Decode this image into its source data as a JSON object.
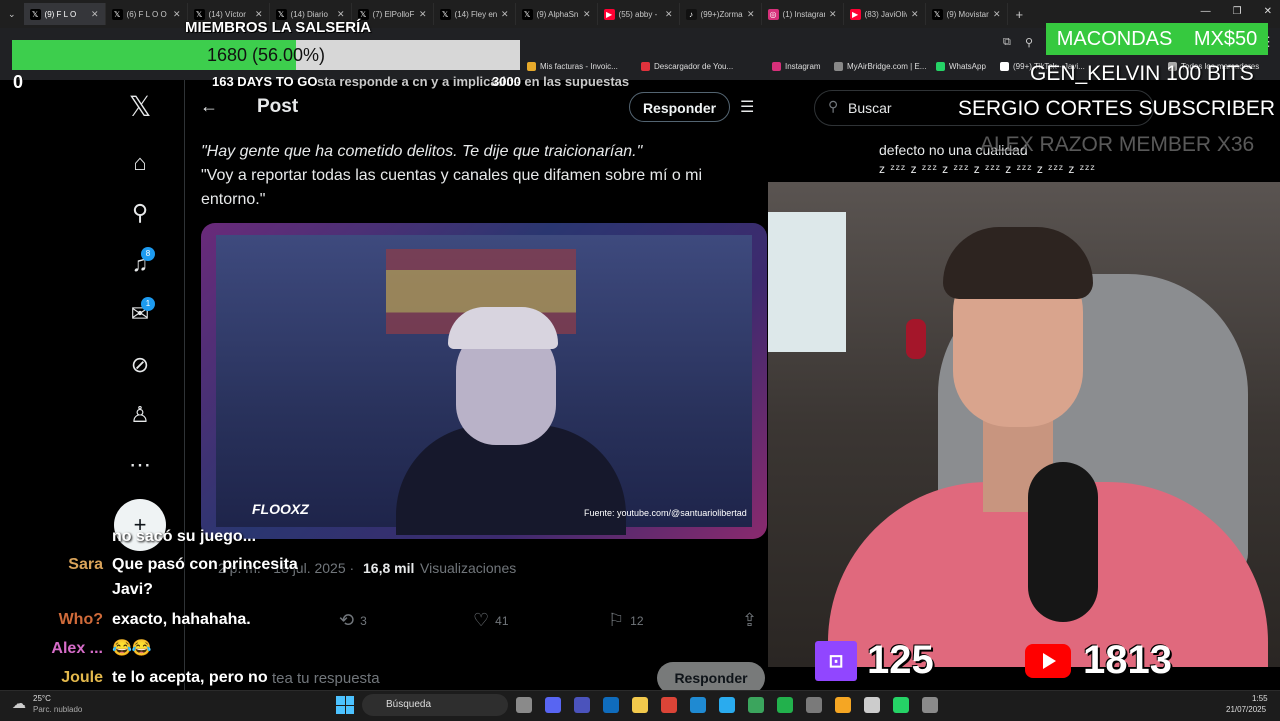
{
  "browser": {
    "tabs": [
      {
        "label": "(9) F L O",
        "icon": "x-icon",
        "active": true
      },
      {
        "label": "(6) F L O O",
        "icon": "x-icon"
      },
      {
        "label": "(14) Víctor",
        "icon": "x-icon"
      },
      {
        "label": "(14) Diario",
        "icon": "x-icon"
      },
      {
        "label": "(7) ElPolloF",
        "icon": "x-icon"
      },
      {
        "label": "(14) Fley en",
        "icon": "x-icon"
      },
      {
        "label": "(9) AlphaSn",
        "icon": "x-icon"
      },
      {
        "label": "(55) abby -",
        "icon": "youtube-icon"
      },
      {
        "label": "(99+)Zorman",
        "icon": "tiktok-icon"
      },
      {
        "label": "(1) Instagram",
        "icon": "instagram-icon"
      },
      {
        "label": "(83) JaviOliv",
        "icon": "youtube-icon"
      },
      {
        "label": "(9) Movistar",
        "icon": "x-icon"
      }
    ],
    "new_tab": "+",
    "bookmarks": [
      {
        "label": "Mis facturas - Invoic...",
        "color": "#e6a92b"
      },
      {
        "label": "Descargador de You...",
        "color": "#e0323c"
      },
      {
        "label": "Instagram",
        "color": "#d6307a"
      },
      {
        "label": "MyAirBridge.com | E...",
        "color": "#888888"
      },
      {
        "label": "WhatsApp",
        "color": "#25d366"
      },
      {
        "label": "(99+) TikTok - Javi...",
        "color": "#ffffff"
      },
      {
        "label": "Todos los marcadores",
        "color": "#aaaaaa"
      }
    ]
  },
  "x_nav": {
    "logo": "𝕏",
    "notifications_badge": "8",
    "messages_badge": "1",
    "compose": "+"
  },
  "post": {
    "back": "←",
    "title": "Post",
    "reply_button": "Responder",
    "line1": "\"Hay gente que ha cometido delitos. Te dije que traicionarían.\"",
    "line2": "\"Voy a reportar todas las cuentas y canales que difamen sobre mí o mi",
    "line3": "entorno.\"",
    "media_logo": "FLOOXZ",
    "media_source": "Fuente: youtube.com/@santuariolibertad",
    "time": "2 p. m. · 18 jul. 2025 ·",
    "views_count": "16,8 mil",
    "views_label": "Visualizaciones",
    "retweets": "3",
    "likes": "41",
    "bookmarks": "12",
    "reply_placeholder": "tea tu respuesta",
    "reply_submit": "Responder",
    "behind_overlay": "sta responde a cn y a implicados en las supuestas"
  },
  "sidebar_right": {
    "search_placeholder": "Buscar",
    "trend_line": "defecto no una cualidad",
    "zz_line": "z ᶻᶻᶻ z ᶻᶻᶻ z ᶻᶻᶻ z ᶻᶻᶻ z ᶻᶻᶻ z ᶻᶻᶻ z ᶻᶻᶻ"
  },
  "stream_goal": {
    "title": "MIEMBROS LA SALSERÍA",
    "progress_text": "1680 (56.00%)",
    "progress": 0.56,
    "start": "0",
    "days": "163 DAYS TO GO",
    "end": "3000"
  },
  "stream_alerts": {
    "donor": "MACONDAS",
    "amount": "MX$50",
    "ticker1": "GEN_KELVIN  100 BITS",
    "ticker2": "SERGIO CORTES  SUBSCRIBER",
    "ticker3": "ALEX RAZOR  MEMBER X36"
  },
  "viewer_counts": {
    "twitch": "125",
    "youtube": "1813"
  },
  "chat": [
    {
      "user": "",
      "message": "no sacó su juego...",
      "color": "#ffffff"
    },
    {
      "user": "Sara",
      "message": "Que pasó con princesita Javi?",
      "color": "#d9a35a"
    },
    {
      "user": "Who?",
      "message": "exacto, hahahaha.",
      "color": "#d06b3a"
    },
    {
      "user": "Alex ...",
      "message": "😂😂",
      "color": "#d66cc8"
    },
    {
      "user": "Joule",
      "message": "te lo acepta, pero no tienes que dar tu",
      "color": "#e3b84c"
    }
  ],
  "taskbar": {
    "temp": "25°C",
    "weather": "Parc. nublado",
    "search": "Búsqueda",
    "time": "1:55",
    "date": "21/07/2025"
  }
}
